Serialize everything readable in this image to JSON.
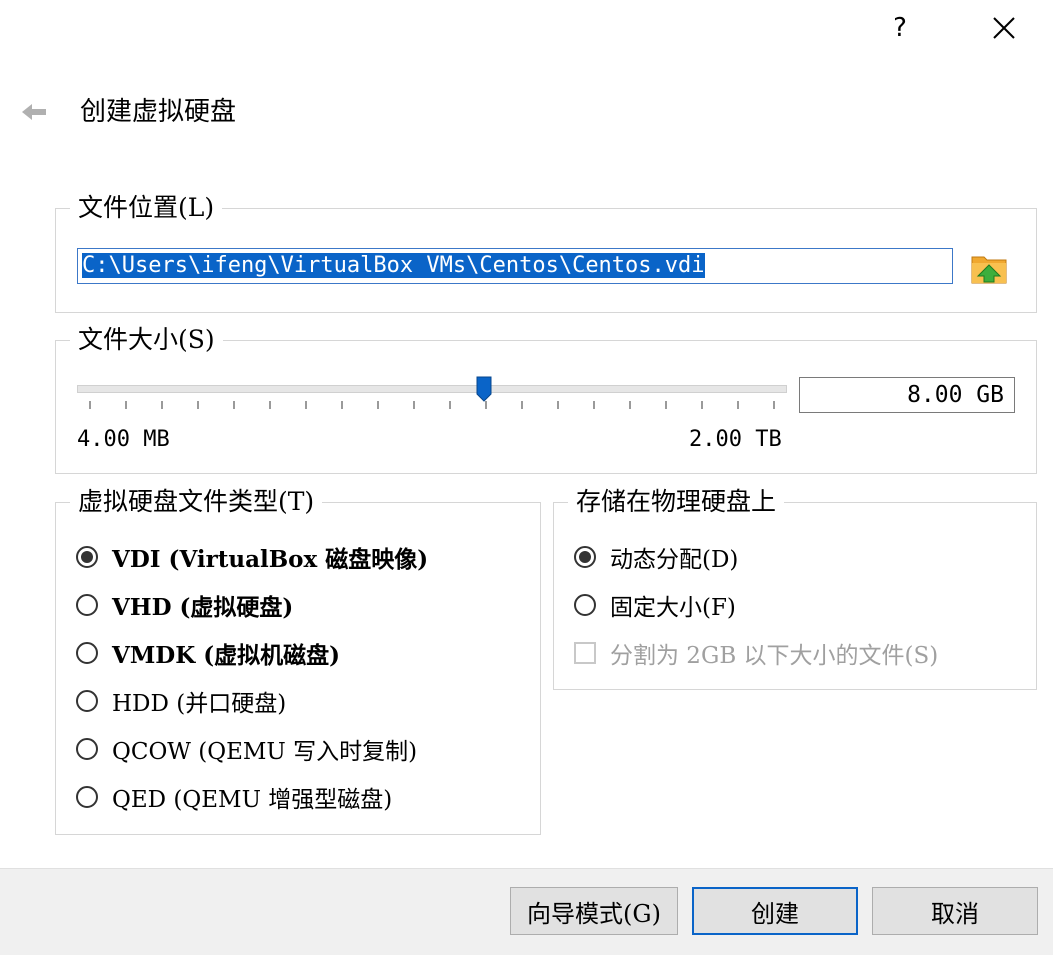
{
  "titlebar": {
    "help": "?",
    "close": "✕"
  },
  "header": {
    "title": "创建虚拟硬盘"
  },
  "file_location": {
    "legend": "文件位置(L)",
    "path": "C:\\Users\\ifeng\\VirtualBox VMs\\Centos\\Centos.vdi"
  },
  "file_size": {
    "legend": "文件大小(S)",
    "value": "8.00 GB",
    "min": "4.00 MB",
    "max": "2.00 TB"
  },
  "disk_type": {
    "legend": "虚拟硬盘文件类型(T)",
    "options": [
      {
        "label": "VDI (VirtualBox 磁盘映像)",
        "checked": true
      },
      {
        "label": "VHD (虚拟硬盘)",
        "checked": false
      },
      {
        "label": "VMDK (虚拟机磁盘)",
        "checked": false
      },
      {
        "label": "HDD (并口硬盘)",
        "checked": false
      },
      {
        "label": "QCOW (QEMU 写入时复制)",
        "checked": false
      },
      {
        "label": "QED (QEMU 增强型磁盘)",
        "checked": false
      }
    ]
  },
  "storage": {
    "legend": "存储在物理硬盘上",
    "options": [
      {
        "label": "动态分配(D)",
        "checked": true
      },
      {
        "label": "固定大小(F)",
        "checked": false
      }
    ],
    "split_label": "分割为 2GB 以下大小的文件(S)"
  },
  "footer": {
    "guided": "向导模式(G)",
    "create": "创建",
    "cancel": "取消"
  },
  "colors": {
    "accent": "#0a64c8"
  }
}
